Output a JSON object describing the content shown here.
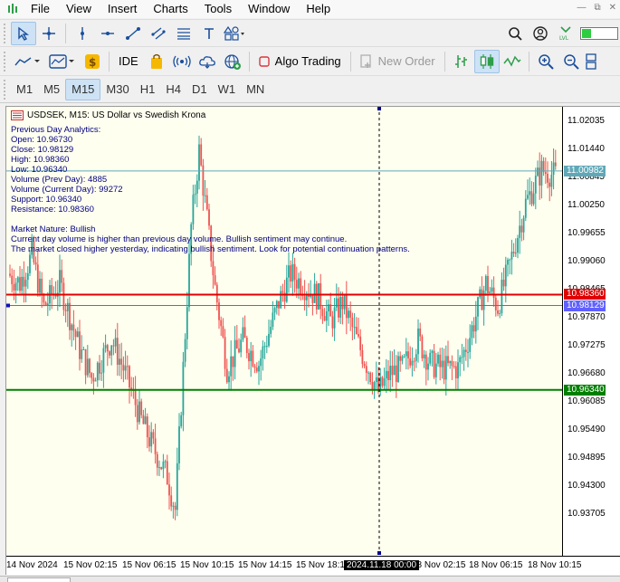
{
  "menu": [
    "File",
    "View",
    "Insert",
    "Charts",
    "Tools",
    "Window",
    "Help"
  ],
  "toolbar2": {
    "ide": "IDE",
    "algo": "Algo Trading",
    "new_order": "New Order"
  },
  "timeframes": [
    "M1",
    "M5",
    "M15",
    "M30",
    "H1",
    "H4",
    "D1",
    "W1",
    "MN"
  ],
  "active_timeframe": "M15",
  "chart": {
    "title": "USDSEK, M15:  US Dollar vs Swedish Krona",
    "analytics": [
      "Previous Day Analytics:",
      "Open: 10.96730",
      "Close: 10.98129",
      "High: 10.98360",
      "Low: 10.96340",
      "Volume (Prev Day): 4885",
      "Volume (Current Day): 99272",
      "Support: 10.96340",
      "Resistance: 10.98360",
      "",
      "Market Nature: Bullish",
      "Current day volume is higher than previous day volume. Bullish sentiment may continue.",
      "The market closed higher yesterday, indicating bullish sentiment. Look for potential continuation patterns."
    ],
    "price_ticks": [
      "11.02035",
      "11.01440",
      "11.00845",
      "11.00250",
      "10.99655",
      "10.99060",
      "10.98465",
      "10.97870",
      "10.97275",
      "10.96680",
      "10.96085",
      "10.95490",
      "10.94895",
      "10.94300",
      "10.93705"
    ],
    "price_tags": {
      "current": "11.00982",
      "resistance": "10.98360",
      "close": "10.98129",
      "support": "10.96340"
    },
    "time_ticks": [
      "14 Nov 2024",
      "15 Nov 02:15",
      "15 Nov 06:15",
      "15 Nov 10:15",
      "15 Nov 14:15",
      "15 Nov 18:15",
      "18 Nov 02:15",
      "18 Nov 06:15",
      "18 Nov 10:15"
    ],
    "crosshair_time": "2024.11.18 00:00",
    "colors": {
      "bull": "#26a69a",
      "bear": "#ef5350",
      "resistance": "#e00000",
      "support": "#008000",
      "close_line": "#6060ff",
      "current_line": "#5fa8b8"
    }
  }
}
